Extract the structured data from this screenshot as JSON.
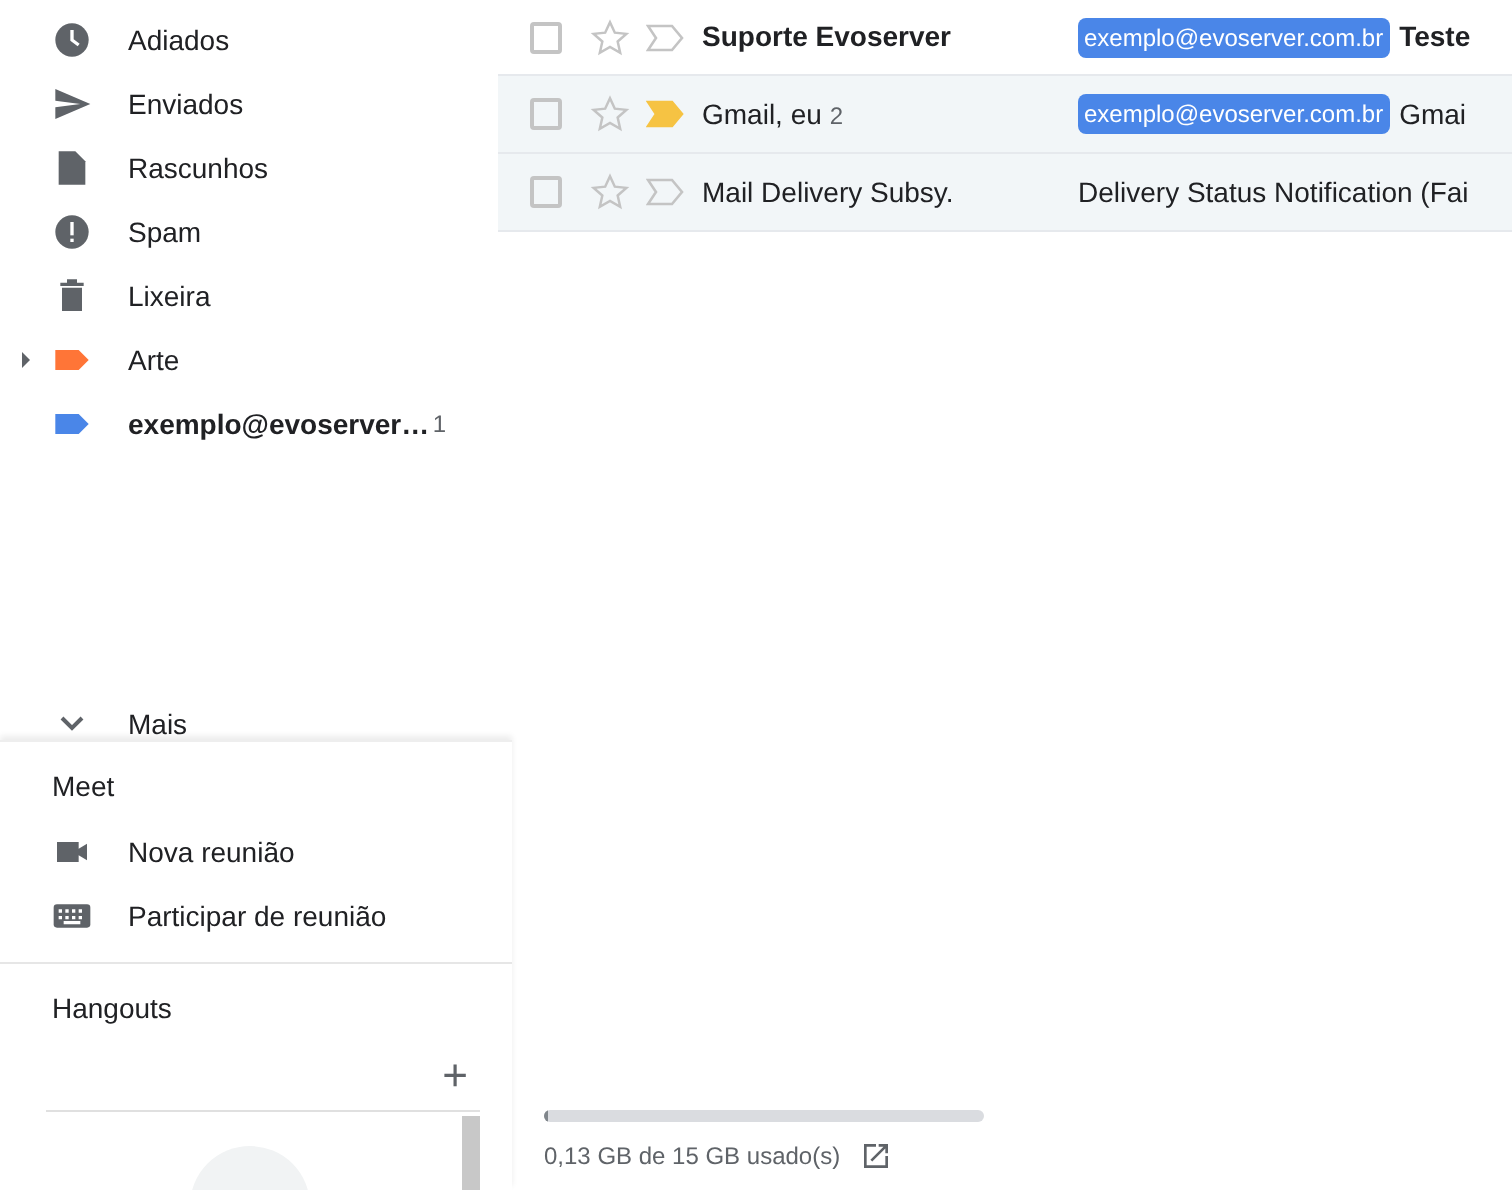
{
  "sidebar": {
    "items": [
      {
        "label": "Adiados",
        "bold": false
      },
      {
        "label": "Enviados",
        "bold": false
      },
      {
        "label": "Rascunhos",
        "bold": false
      },
      {
        "label": "Spam",
        "bold": false
      },
      {
        "label": "Lixeira",
        "bold": false
      },
      {
        "label": "Arte",
        "color": "#ff7537",
        "expandable": true,
        "bold": false
      },
      {
        "label": "exemplo@evoserver…",
        "color": "#4a86e8",
        "count": "1",
        "bold": true,
        "expandable": false
      }
    ],
    "more": "Mais"
  },
  "meet": {
    "title": "Meet",
    "items": [
      {
        "label": "Nova reunião"
      },
      {
        "label": "Participar de reunião"
      }
    ]
  },
  "hangouts": {
    "title": "Hangouts",
    "add": "+"
  },
  "emails": [
    {
      "sender": "Suporte Evoserver",
      "unread": true,
      "important": false,
      "starred": false,
      "checked": false,
      "label": "exemplo@evoserver.com.br",
      "subject": "Teste"
    },
    {
      "sender": "Gmail, eu",
      "count": "2",
      "unread": false,
      "important": true,
      "starred": false,
      "checked": false,
      "label": "exemplo@evoserver.com.br",
      "subject": "Gmai"
    },
    {
      "sender": "Mail Delivery Subsy.",
      "unread": false,
      "important": false,
      "starred": false,
      "checked": false,
      "subject": "Delivery Status Notification (Fai"
    }
  ],
  "storage": {
    "level": 0.01,
    "text": "0,13 GB de 15 GB usado(s)"
  }
}
